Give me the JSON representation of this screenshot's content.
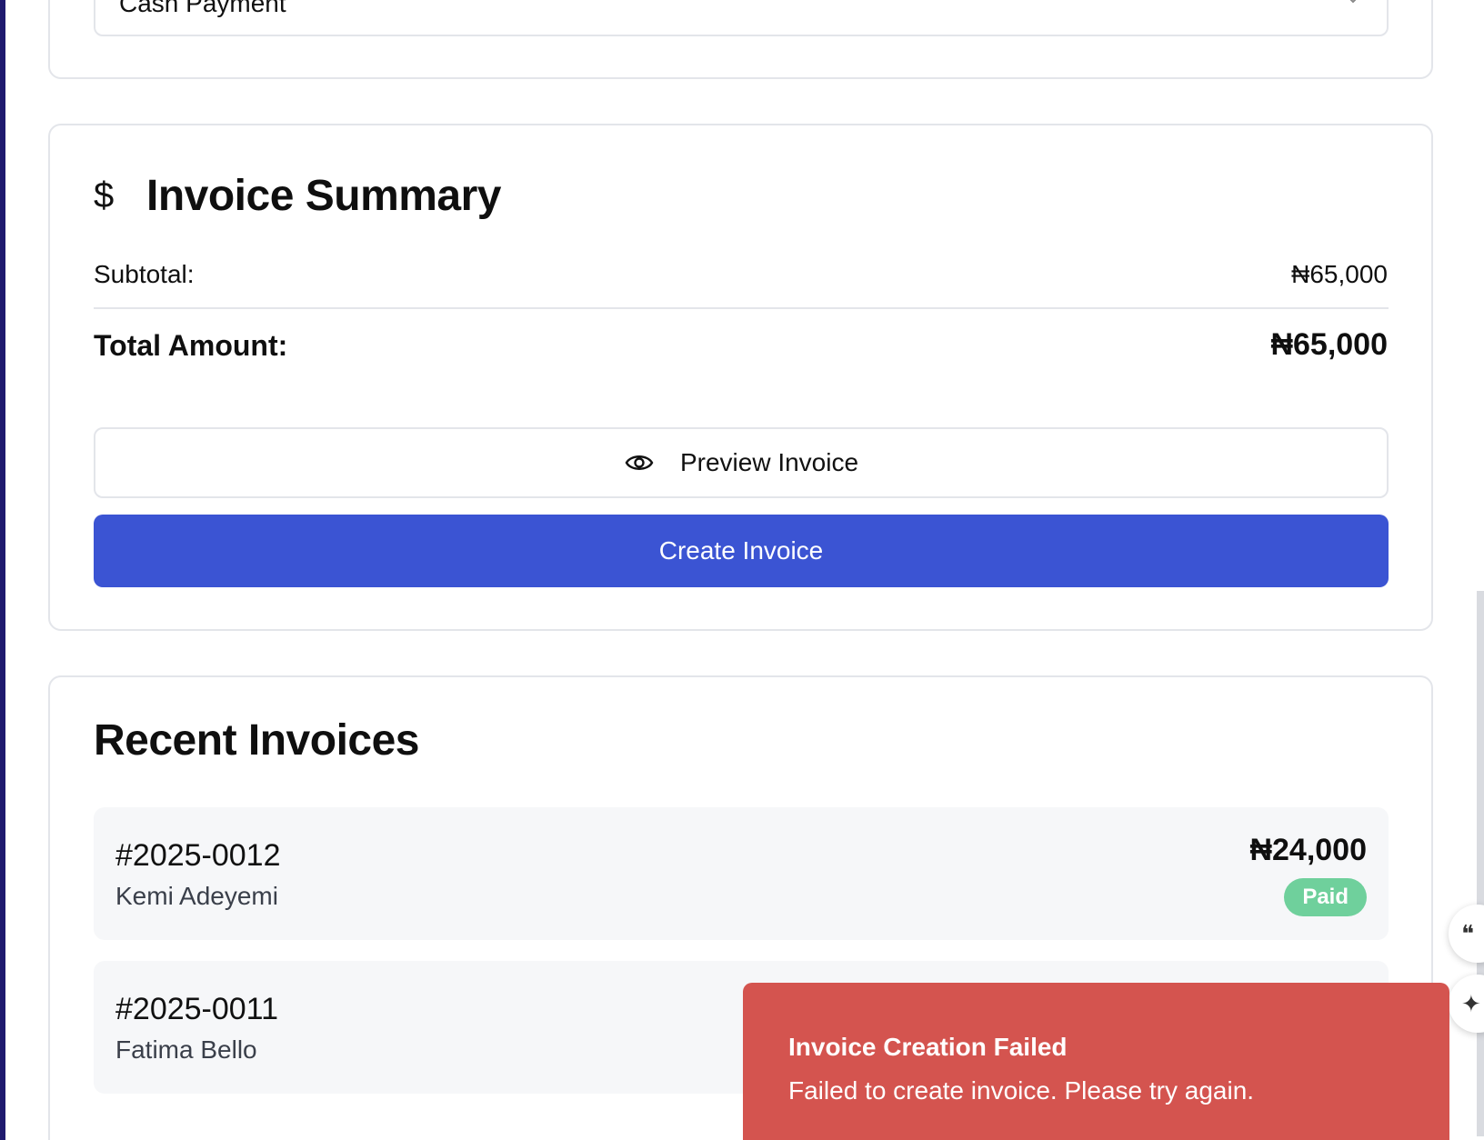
{
  "payment": {
    "selected_method": "Cash Payment"
  },
  "summary": {
    "title": "Invoice Summary",
    "subtotal_label": "Subtotal:",
    "subtotal_value": "₦65,000",
    "total_label": "Total Amount:",
    "total_value": "₦65,000",
    "preview_label": "Preview Invoice",
    "create_label": "Create Invoice"
  },
  "recent": {
    "title": "Recent Invoices",
    "invoices": [
      {
        "number": "#2025-0012",
        "client": "Kemi Adeyemi",
        "amount": "₦24,000",
        "status": "Paid"
      },
      {
        "number": "#2025-0011",
        "client": "Fatima Bello"
      }
    ]
  },
  "toast": {
    "title": "Invoice Creation Failed",
    "message": "Failed to create invoice. Please try again."
  },
  "colors": {
    "primary": "#3b54d3",
    "paid_badge": "#6fd09c",
    "error_toast": "#d4544f"
  },
  "icons": {
    "summary": "dollar-icon",
    "preview": "eye-icon",
    "select": "chevron-down-icon",
    "float_1": "quote-list-icon",
    "float_2": "sparkle-icon"
  }
}
